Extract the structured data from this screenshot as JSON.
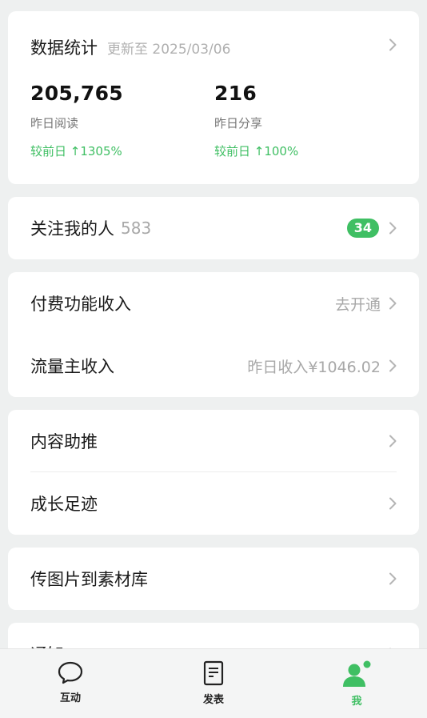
{
  "stats": {
    "title": "数据统计",
    "updated": "更新至 2025/03/06",
    "items": [
      {
        "value": "205,765",
        "label": "昨日阅读",
        "change": "较前日 ↑1305%"
      },
      {
        "value": "216",
        "label": "昨日分享",
        "change": "较前日 ↑100%"
      }
    ]
  },
  "followers": {
    "label": "关注我的人",
    "count": "583",
    "badge": "34"
  },
  "income": {
    "paid": {
      "label": "付费功能收入",
      "hint": "去开通"
    },
    "traffic": {
      "label": "流量主收入",
      "hint": "昨日收入¥1046.02"
    }
  },
  "content": {
    "promote": {
      "label": "内容助推"
    },
    "growth": {
      "label": "成长足迹"
    }
  },
  "upload": {
    "label": "传图片到素材库"
  },
  "notice": {
    "label": "通知"
  },
  "tabbar": {
    "items": [
      {
        "label": "互动",
        "icon": "chat-bubble-icon"
      },
      {
        "label": "发表",
        "icon": "document-icon"
      },
      {
        "label": "我",
        "icon": "profile-icon"
      }
    ],
    "active_index": 2,
    "accent": "#3fbf63"
  }
}
